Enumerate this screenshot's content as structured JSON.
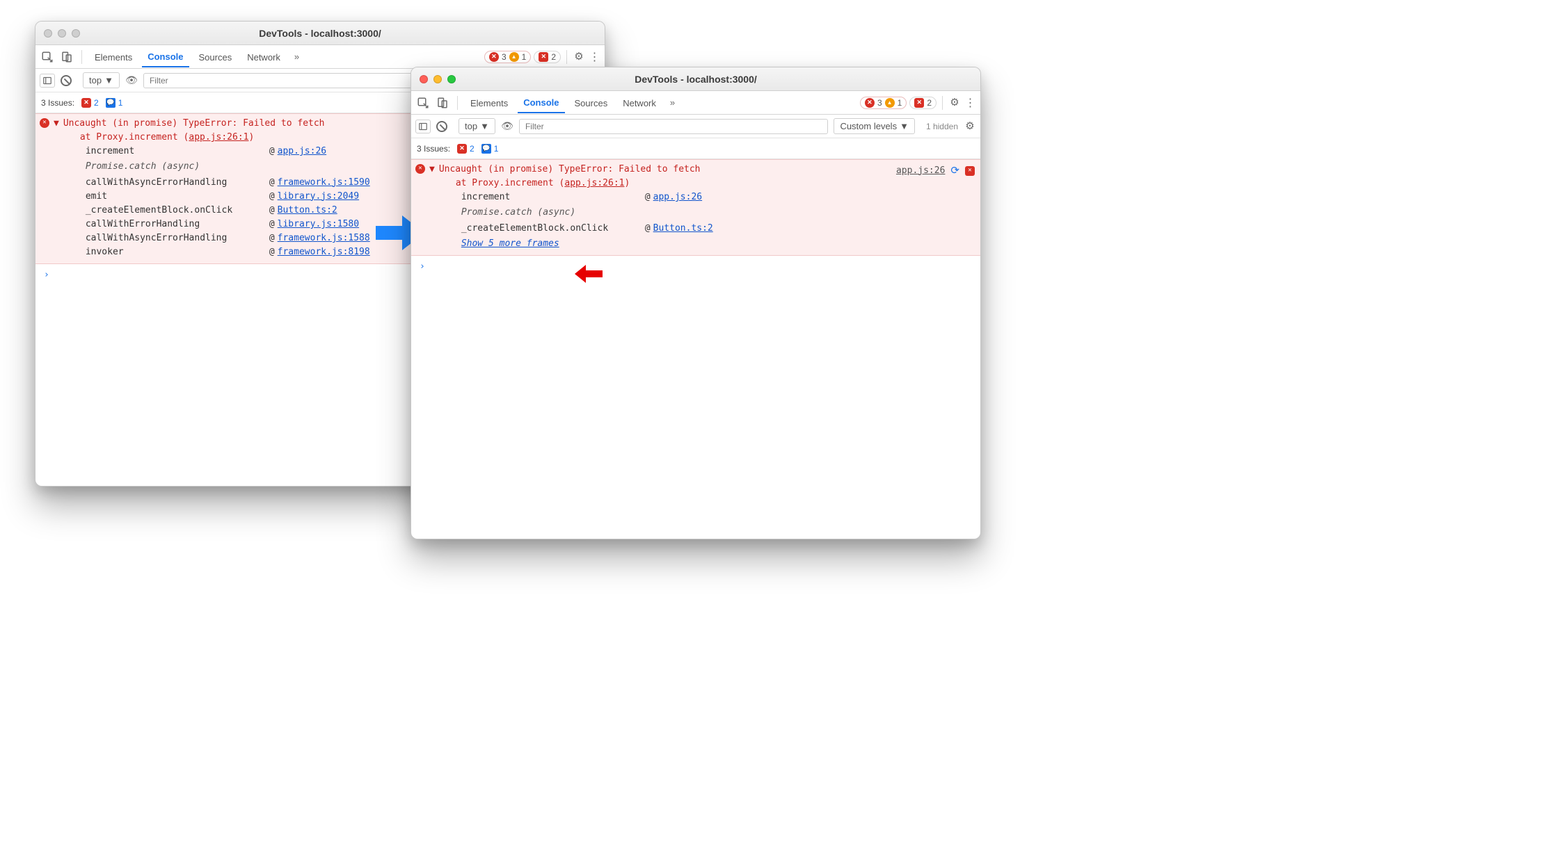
{
  "windowA": {
    "title": "DevTools - localhost:3000/",
    "tabs": {
      "elements": "Elements",
      "console": "Console",
      "sources": "Sources",
      "network": "Network"
    },
    "counts": {
      "errors": "3",
      "warnings": "1",
      "issues": "2"
    },
    "filter": {
      "context": "top",
      "placeholder": "Filter"
    },
    "issues": {
      "label": "3 Issues:",
      "red": "2",
      "blue": "1"
    },
    "error": {
      "head": "Uncaught (in promise) TypeError: Failed to fetch",
      "at": "at Proxy.increment (",
      "atLink": "app.js:26:1",
      "atClose": ")",
      "stack": [
        {
          "fn": "increment",
          "link": "app.js:26"
        }
      ],
      "async": "Promise.catch (async)",
      "stack2": [
        {
          "fn": "callWithAsyncErrorHandling",
          "link": "framework.js:1590"
        },
        {
          "fn": "emit",
          "link": "library.js:2049"
        },
        {
          "fn": "_createElementBlock.onClick",
          "link": "Button.ts:2"
        },
        {
          "fn": "callWithErrorHandling",
          "link": "library.js:1580"
        },
        {
          "fn": "callWithAsyncErrorHandling",
          "link": "framework.js:1588"
        },
        {
          "fn": "invoker",
          "link": "framework.js:8198"
        }
      ]
    }
  },
  "windowB": {
    "title": "DevTools - localhost:3000/",
    "tabs": {
      "elements": "Elements",
      "console": "Console",
      "sources": "Sources",
      "network": "Network"
    },
    "counts": {
      "errors": "3",
      "warnings": "1",
      "issues": "2"
    },
    "filter": {
      "context": "top",
      "placeholder": "Filter",
      "levels": "Custom levels",
      "hidden": "1 hidden"
    },
    "issues": {
      "label": "3 Issues:",
      "red": "2",
      "blue": "1"
    },
    "error": {
      "head": "Uncaught (in promise) TypeError: Failed to fetch",
      "at": "at Proxy.increment (",
      "atLink": "app.js:26:1",
      "atClose": ")",
      "sourceLink": "app.js:26",
      "stack": [
        {
          "fn": "increment",
          "link": "app.js:26"
        }
      ],
      "async": "Promise.catch (async)",
      "stack2": [
        {
          "fn": "_createElementBlock.onClick",
          "link": "Button.ts:2"
        }
      ],
      "showMore": "Show 5 more frames"
    }
  }
}
